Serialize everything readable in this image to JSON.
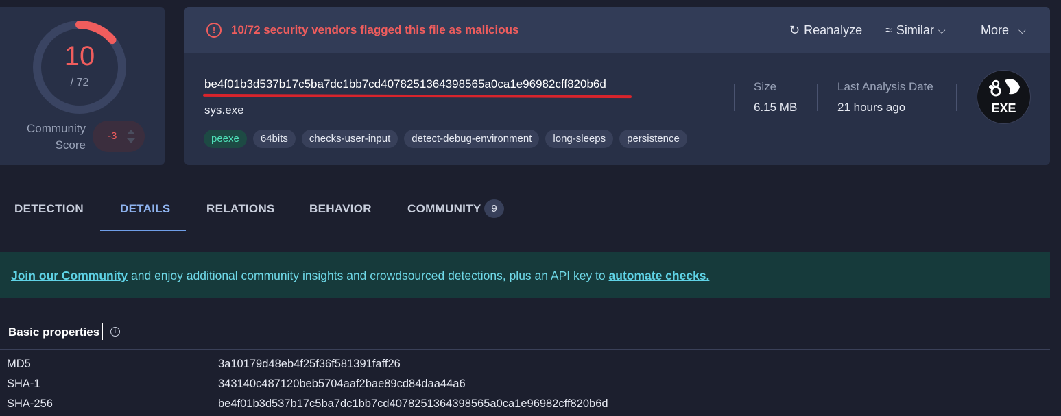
{
  "score": {
    "detections": "10",
    "total": "/ 72",
    "community_label_1": "Community",
    "community_label_2": "Score",
    "community_value": "-3",
    "detection_fraction": 0.139
  },
  "alert": {
    "icon": "exclamation-circle-icon",
    "text": "10/72 security vendors flagged this file as malicious"
  },
  "actions": {
    "reanalyze": "Reanalyze",
    "similar": "Similar",
    "more": "More"
  },
  "file": {
    "hash": "be4f01b3d537b17c5ba7dc1bb7cd4078251364398565a0ca1e96982cff820b6d",
    "name": "sys.exe",
    "tags": [
      "peexe",
      "64bits",
      "checks-user-input",
      "detect-debug-environment",
      "long-sleeps",
      "persistence"
    ],
    "size_label": "Size",
    "size_value": "6.15 MB",
    "date_label": "Last Analysis Date",
    "date_value": "21 hours ago",
    "type_badge": "EXE"
  },
  "tabs": [
    {
      "label": "DETECTION"
    },
    {
      "label": "DETAILS"
    },
    {
      "label": "RELATIONS"
    },
    {
      "label": "BEHAVIOR"
    },
    {
      "label": "COMMUNITY"
    }
  ],
  "community_count": "9",
  "banner": {
    "link1": "Join our Community",
    "middle": " and enjoy additional community insights and crowdsourced detections, plus an API key to ",
    "link2": "automate checks."
  },
  "basic_properties": {
    "title": "Basic properties",
    "rows": [
      {
        "key": "MD5",
        "value": "3a10179d48eb4f25f36f581391faff26"
      },
      {
        "key": "SHA-1",
        "value": "343140c487120beb5704aaf2bae89cd84daa44a6"
      },
      {
        "key": "SHA-256",
        "value": "be4f01b3d537b17c5ba7dc1bb7cd4078251364398565a0ca1e96982cff820b6d"
      }
    ]
  },
  "colors": {
    "malicious": "#f05d5d",
    "accent": "#6f9ee8",
    "banner_bg": "#163a3b"
  }
}
